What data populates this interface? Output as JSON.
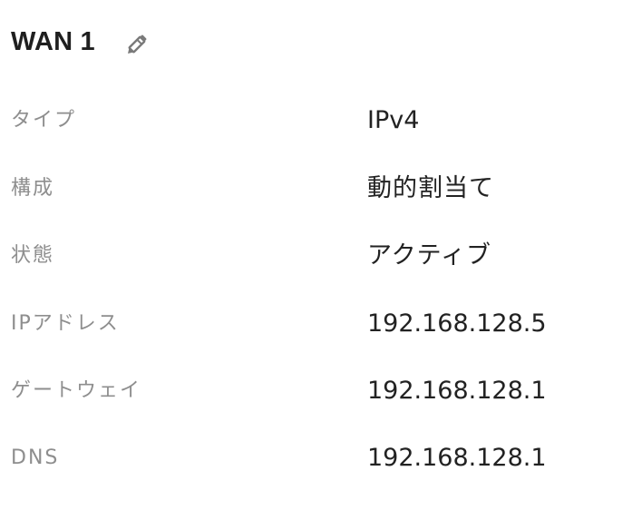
{
  "header": {
    "title": "WAN 1",
    "edit_icon": "pencil-icon"
  },
  "rows": [
    {
      "label": "タイプ",
      "value": "IPv4"
    },
    {
      "label": "構成",
      "value": "動的割当て"
    },
    {
      "label": "状態",
      "value": "アクティブ"
    },
    {
      "label": "IPアドレス",
      "value": "192.168.128.5"
    },
    {
      "label": "ゲートウェイ",
      "value": "192.168.128.1"
    },
    {
      "label": "DNS",
      "value": "192.168.128.1"
    }
  ],
  "colors": {
    "title": "#1f1f1f",
    "label": "#8e8e8e",
    "value": "#222222",
    "icon": "#7a7a7a"
  }
}
